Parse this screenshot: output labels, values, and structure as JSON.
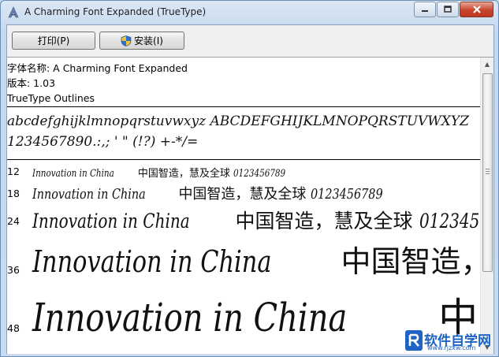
{
  "window": {
    "title": "A Charming Font Expanded (TrueType)"
  },
  "toolbar": {
    "print_label": "打印(P)",
    "install_label": "安装(I)"
  },
  "font_info": {
    "name_line": "字体名称: A Charming Font Expanded",
    "version_line": "版本: 1.03",
    "outline_line": "TrueType Outlines"
  },
  "charset": {
    "lowercase_uppercase": "abcdefghijklmnopqrstuvwxyz ABCDEFGHIJKLMNOPQRSTUVWXYZ",
    "digits_symbols": "1234567890.:,; ' \" (!?) +-*/="
  },
  "samples": [
    {
      "size": "12",
      "latin": "Innovation in China",
      "cjk": "中国智造，慧及全球",
      "digits": "0123456789"
    },
    {
      "size": "18",
      "latin": "Innovation in China",
      "cjk": "中国智造，慧及全球",
      "digits": "0123456789"
    },
    {
      "size": "24",
      "latin": "Innovation in China",
      "cjk": "中国智造，慧及全球",
      "digits": "012345"
    },
    {
      "size": "36",
      "latin": "Innovation in China",
      "cjk": "中国智造，慧及",
      "digits": ""
    },
    {
      "size": "48",
      "latin": "Innovation in China",
      "cjk": "中国智造",
      "digits": ""
    }
  ],
  "watermark": {
    "text": "软件自学网",
    "url": "www.rjzxw.com"
  },
  "icons": {
    "app": "font-viewer-app-icon",
    "shield": "uac-shield-icon",
    "minimize": "minimize-icon",
    "maximize": "maximize-icon",
    "close": "close-icon"
  },
  "colors": {
    "titlebar": "#c9daee",
    "close": "#c7452e",
    "watermark": "#1e63c5"
  }
}
